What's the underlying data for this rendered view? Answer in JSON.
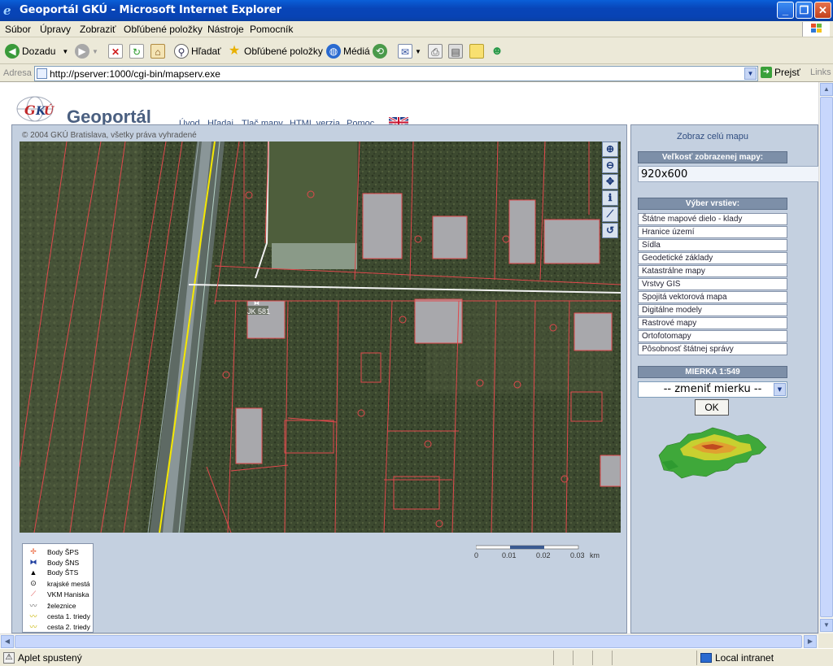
{
  "window": {
    "title": "Geoportál GKÚ - Microsoft Internet Explorer"
  },
  "menu": [
    "Súbor",
    "Úpravy",
    "Zobraziť",
    "Obľúbené položky",
    "Nástroje",
    "Pomocník"
  ],
  "toolbar": {
    "back": "Dozadu",
    "search": "Hľadať",
    "favorites": "Obľúbené položky",
    "media": "Médiá"
  },
  "address": {
    "label": "Adresa",
    "url": "http://pserver:1000/cgi-bin/mapserv.exe",
    "go": "Prejsť",
    "links": "Links"
  },
  "page": {
    "site_name": "Geoportál",
    "logo_text": "GKÚ",
    "nav": [
      "Úvod",
      "Hľadaj",
      "Tlač mapy",
      "HTML verzia",
      "Pomoc"
    ],
    "copyright": "© 2004 GKÚ Bratislava, všetky práva vyhradené",
    "map_label": "JK 581",
    "legend": [
      {
        "symbol": "body-sps-icon",
        "label": "Body ŠPS"
      },
      {
        "symbol": "body-sns-icon",
        "label": "Body ŠNS"
      },
      {
        "symbol": "body-sts-icon",
        "label": "Body ŠTS"
      },
      {
        "symbol": "city-icon",
        "label": "krajské mestá"
      },
      {
        "symbol": "vkm-line-icon",
        "label": "VKM Haniska"
      },
      {
        "symbol": "railway-icon",
        "label": "železnice"
      },
      {
        "symbol": "road1-icon",
        "label": "cesta 1. triedy"
      },
      {
        "symbol": "road2-icon",
        "label": "cesta 2. triedy"
      }
    ],
    "scalebar": {
      "ticks": [
        "0",
        "0.01",
        "0.02",
        "0.03"
      ],
      "unit": "km"
    }
  },
  "sidepanel": {
    "full_map": "Zobraz celú mapu",
    "size_head": "Veľkosť zobrazenej mapy:",
    "size_value": "920x600",
    "layers_head": "Výber vrstiev:",
    "layers": [
      "Štátne mapové dielo - klady",
      "Hranice území",
      "Sídla",
      "Geodetické základy",
      "Katastrálne mapy",
      "Vrstvy GIS",
      "Spojitá vektorová mapa",
      "Digitálne modely",
      "Rastrové mapy",
      "Ortofotomapy",
      "Pôsobnosť štátnej správy"
    ],
    "scale_head": "MIERKA 1:549",
    "scale_select": "-- zmeniť mierku --",
    "ok": "OK"
  },
  "status": {
    "left": "Aplet spustený",
    "zone": "Local intranet"
  },
  "colors": {
    "titlebar": "#0845b8",
    "panel": "#c4d0e0",
    "parcel_lines": "#e0484c",
    "road_yellow": "#f5e800"
  }
}
